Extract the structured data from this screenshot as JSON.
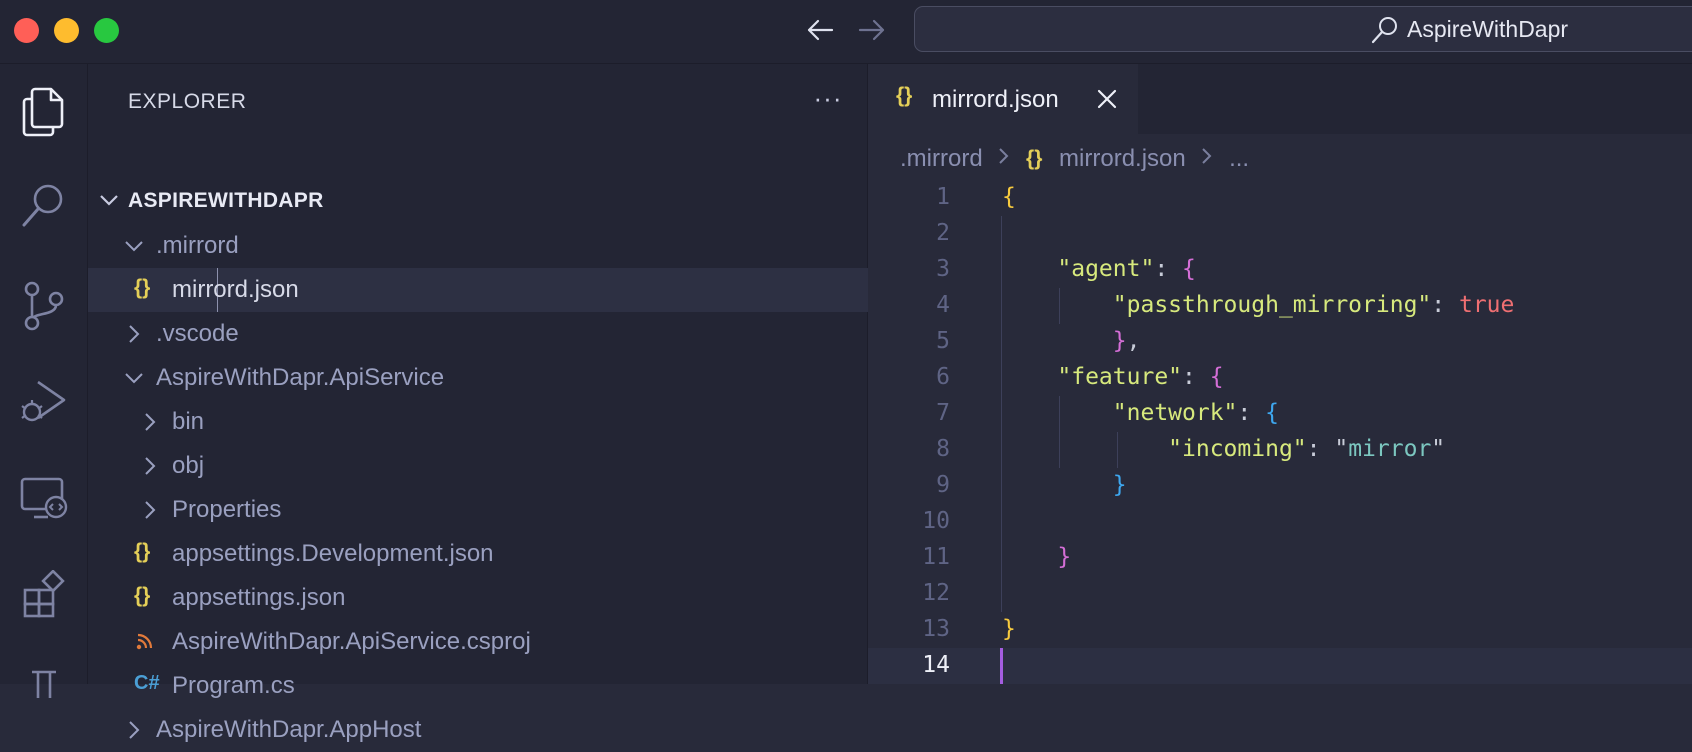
{
  "window": {
    "search_text": "AspireWithDapr",
    "traffic_light_colors": [
      "#ff5f57",
      "#febc2e",
      "#28c840"
    ]
  },
  "activity_bar": {
    "icons": [
      "explorer-icon",
      "search-icon",
      "source-control-icon",
      "run-debug-icon",
      "remote-explorer-icon",
      "extensions-icon",
      "testing-icon"
    ]
  },
  "explorer": {
    "title": "EXPLORER",
    "more_label": "···",
    "root": "ASPIREWITHDAPR",
    "items": [
      {
        "label": ".mirrord",
        "type": "folder",
        "expanded": true
      },
      {
        "label": "mirrord.json",
        "type": "json",
        "icon": "{}",
        "selected": true
      },
      {
        "label": ".vscode",
        "type": "folder",
        "expanded": false
      },
      {
        "label": "AspireWithDapr.ApiService",
        "type": "folder",
        "expanded": true
      },
      {
        "label": "bin",
        "type": "folder",
        "expanded": false
      },
      {
        "label": "obj",
        "type": "folder",
        "expanded": false
      },
      {
        "label": "Properties",
        "type": "folder",
        "expanded": false
      },
      {
        "label": "appsettings.Development.json",
        "type": "json",
        "icon": "{}"
      },
      {
        "label": "appsettings.json",
        "type": "json",
        "icon": "{}"
      },
      {
        "label": "AspireWithDapr.ApiService.csproj",
        "type": "rss",
        "icon": "rss-icon"
      },
      {
        "label": "Program.cs",
        "type": "csharp",
        "icon": "C#"
      },
      {
        "label": "AspireWithDapr.AppHost",
        "type": "folder",
        "expanded": false
      }
    ]
  },
  "editor": {
    "tab": {
      "icon": "{}",
      "label": "mirrord.json"
    },
    "breadcrumb": [
      ".mirrord",
      "{}",
      "mirrord.json",
      "..."
    ],
    "active_line": 14,
    "lines": [
      {
        "n": "1",
        "text": "{"
      },
      {
        "n": "2",
        "text": ""
      },
      {
        "n": "3",
        "text": "    \"agent\": {"
      },
      {
        "n": "4",
        "text": "        \"passthrough_mirroring\": true"
      },
      {
        "n": "5",
        "text": "    },"
      },
      {
        "n": "6",
        "text": "\"feature\": {"
      },
      {
        "n": "7",
        "text": "    \"network\": {"
      },
      {
        "n": "8",
        "text": "        \"incoming\": \"mirror\""
      },
      {
        "n": "9",
        "text": "    }"
      },
      {
        "n": "10",
        "text": ""
      },
      {
        "n": "11",
        "text": "}"
      },
      {
        "n": "12",
        "text": ""
      },
      {
        "n": "13",
        "text": "}"
      },
      {
        "n": "14",
        "text": ""
      }
    ]
  }
}
